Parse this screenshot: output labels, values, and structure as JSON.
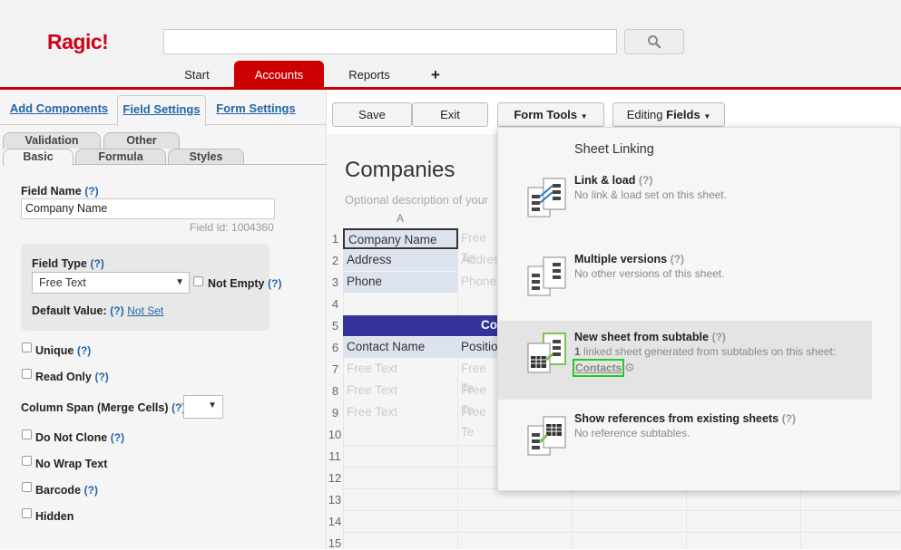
{
  "app": {
    "logo": "Ragic!"
  },
  "nav": {
    "tabs": [
      "Start",
      "Accounts",
      "Reports"
    ],
    "add_symbol": "+"
  },
  "left_panel": {
    "tabs": [
      "Add Components",
      "Field Settings",
      "Form Settings"
    ],
    "subtabs_top": [
      "Validation",
      "Other"
    ],
    "subtabs_bottom": [
      "Basic",
      "Formula",
      "Styles"
    ],
    "field_name_label": "Field Name",
    "help": "(?)",
    "field_name_value": "Company Name",
    "field_id": "Field Id: 1004360",
    "field_type_label": "Field Type",
    "field_type_value": "Free Text",
    "not_empty": "Not Empty",
    "default_value_label": "Default Value:",
    "default_value_link": "Not Set",
    "unique": "Unique",
    "read_only": "Read Only",
    "column_span": "Column Span (Merge Cells)",
    "do_not_clone": "Do Not Clone",
    "no_wrap": "No Wrap Text",
    "barcode": "Barcode",
    "hidden": "Hidden"
  },
  "toolbar": {
    "save": "Save",
    "exit": "Exit",
    "form_tools": "Form Tools",
    "editing_prefix": "Editing",
    "editing_bold": "Fields"
  },
  "sheet": {
    "title": "Companies",
    "description": "Optional description of your",
    "col_a": "A",
    "row_numbers": [
      "1",
      "2",
      "3",
      "4",
      "5",
      "6",
      "7",
      "8",
      "9",
      "10",
      "11",
      "12",
      "13",
      "14",
      "15"
    ],
    "fields": [
      "Company Name",
      "Address",
      "Phone"
    ],
    "free_text_partial": "Free Te",
    "address_partial": "Addres",
    "phone_partial": "Phone",
    "section_partial": "Co",
    "contact_name": "Contact Name",
    "position_partial": "Positio",
    "free_text": "Free Text"
  },
  "popup": {
    "header": "Sheet Linking",
    "options": [
      {
        "title": "Link & load",
        "help": "(?)",
        "desc": "No link & load set on this sheet."
      },
      {
        "title": "Multiple versions",
        "help": "(?)",
        "desc": "No other versions of this sheet."
      },
      {
        "title": "New sheet from subtable",
        "help": "(?)",
        "desc_count": "1",
        "desc": " linked sheet generated from subtables on this sheet:",
        "link": "Contacts"
      },
      {
        "title": "Show references from existing sheets",
        "help": "(?)",
        "desc": "No reference subtables."
      }
    ]
  },
  "colors": {
    "brand": "#cc0000",
    "link": "#2266aa",
    "highlight": "#33cc33"
  }
}
